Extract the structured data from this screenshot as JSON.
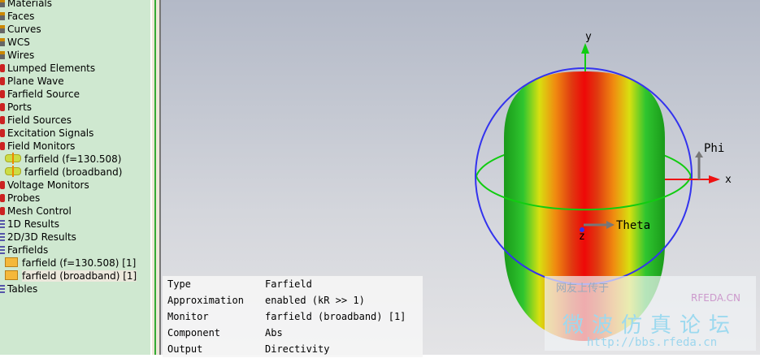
{
  "tree": {
    "items": [
      {
        "label": "Materials",
        "icon": "gray"
      },
      {
        "label": "Faces",
        "icon": "gray"
      },
      {
        "label": "Curves",
        "icon": "gray"
      },
      {
        "label": "WCS",
        "icon": "gray"
      },
      {
        "label": "Wires",
        "icon": "gray"
      },
      {
        "label": "Lumped Elements",
        "icon": "red"
      },
      {
        "label": "Plane Wave",
        "icon": "red"
      },
      {
        "label": "Farfield Source",
        "icon": "red"
      },
      {
        "label": "Ports",
        "icon": "red"
      },
      {
        "label": "Field Sources",
        "icon": "red"
      },
      {
        "label": "Excitation Signals",
        "icon": "red"
      },
      {
        "label": "Field Monitors",
        "icon": "red"
      },
      {
        "label": "farfield (f=130.508)",
        "icon": "monitor"
      },
      {
        "label": "farfield (broadband)",
        "icon": "monitor"
      },
      {
        "label": "Voltage Monitors",
        "icon": "red"
      },
      {
        "label": "Probes",
        "icon": "red"
      },
      {
        "label": "Mesh Control",
        "icon": "red"
      },
      {
        "label": "1D Results",
        "icon": "blue"
      },
      {
        "label": "2D/3D Results",
        "icon": "blue"
      },
      {
        "label": "Farfields",
        "icon": "blue"
      },
      {
        "label": "farfield (f=130.508) [1]",
        "icon": "folder"
      },
      {
        "label": "farfield (broadband) [1]",
        "icon": "folder",
        "selected": true
      },
      {
        "label": "Tables",
        "icon": "blue"
      }
    ]
  },
  "axes": {
    "y": "y",
    "x": "x",
    "z": "z",
    "phi": "Phi",
    "theta": "Theta"
  },
  "info": [
    [
      "Type",
      "Farfield"
    ],
    [
      "Approximation",
      "enabled (kR >> 1)"
    ],
    [
      "Monitor",
      "farfield (broadband) [1]"
    ],
    [
      "Component",
      "Abs"
    ],
    [
      "Output",
      "Directivity"
    ]
  ],
  "watermark": {
    "line1": "网友上传于",
    "brand": "RFEDA.CN",
    "title": "微波仿真论坛",
    "url": "http://bbs.rfeda.cn"
  }
}
